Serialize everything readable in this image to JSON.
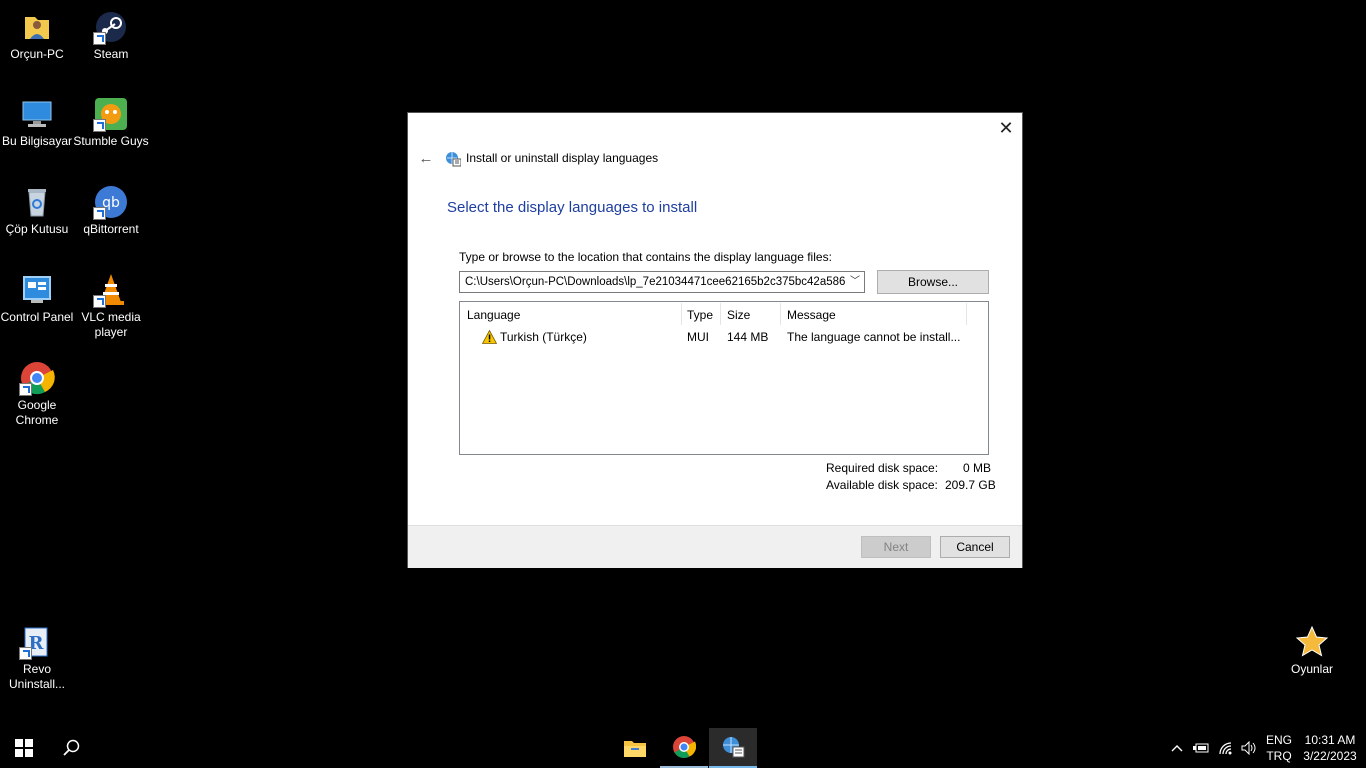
{
  "desktop": {
    "icons": [
      {
        "label": "Orçun-PC"
      },
      {
        "label": "Steam"
      },
      {
        "label": "Bu Bilgisayar"
      },
      {
        "label": "Stumble Guys"
      },
      {
        "label": "Çöp Kutusu"
      },
      {
        "label": "qBittorrent"
      },
      {
        "label": "Control Panel"
      },
      {
        "label": "VLC media player"
      },
      {
        "label": "Google Chrome"
      },
      {
        "label": "Revo Uninstall..."
      },
      {
        "label": "Oyunlar"
      }
    ]
  },
  "dialog": {
    "title": "Install or uninstall display languages",
    "heading": "Select the display languages to install",
    "prompt": "Type or browse to the location that contains the display language files:",
    "path_value": "C:\\Users\\Orçun-PC\\Downloads\\lp_7e21034471cee62165b2c375bc42a586",
    "browse_label": "Browse...",
    "columns": [
      "Language",
      "Type",
      "Size",
      "Message"
    ],
    "rows": [
      {
        "language": "Turkish (Türkçe)",
        "type": "MUI",
        "size": "144 MB",
        "message": "The language cannot be install..."
      }
    ],
    "disk": {
      "required_label": "Required disk space:",
      "required_value": "0 MB",
      "available_label": "Available disk space:",
      "available_value": "209.7 GB"
    },
    "next_label": "Next",
    "cancel_label": "Cancel"
  },
  "taskbar": {
    "lang_top": "ENG",
    "lang_bottom": "TRQ",
    "time": "10:31 AM",
    "date": "3/22/2023"
  },
  "colors": {
    "heading": "#1e3ea0",
    "accent": "#76b9ed",
    "warning": "#f7c600"
  }
}
